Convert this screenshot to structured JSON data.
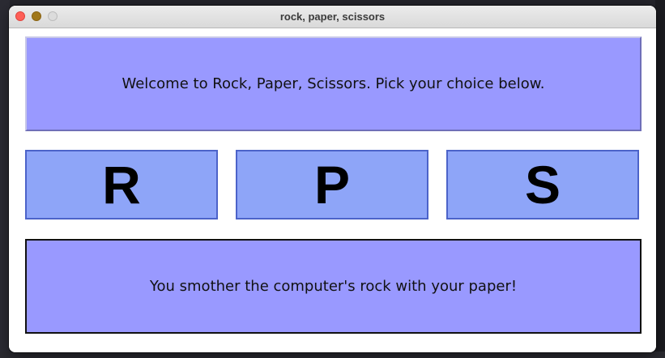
{
  "window": {
    "title": "rock, paper, scissors"
  },
  "prompt": {
    "text": "Welcome to Rock, Paper, Scissors. Pick your choice below."
  },
  "choices": [
    {
      "label": "R"
    },
    {
      "label": "P"
    },
    {
      "label": "S"
    }
  ],
  "result": {
    "text": "You smother the computer's rock with your paper!"
  },
  "colors": {
    "message_bg": "#9999ff",
    "choice_bg": "#8ea5f8",
    "choice_border": "#4c63c9",
    "close_light": "#fe5f57",
    "minimize_light": "#a0771a",
    "zoom_light": "#dcdcdc"
  }
}
